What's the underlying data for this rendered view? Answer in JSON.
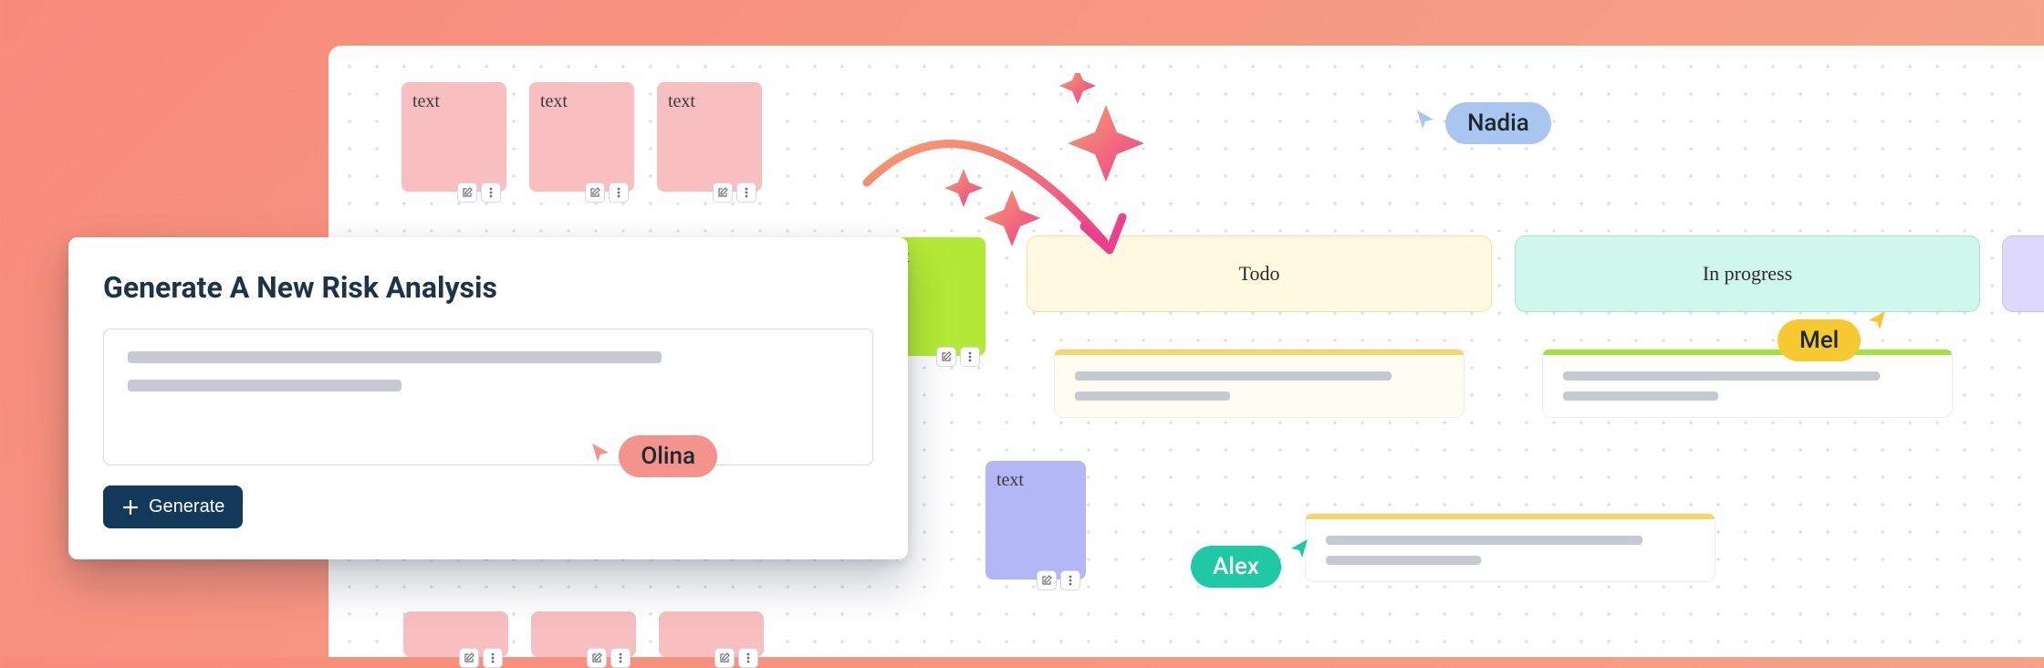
{
  "notes": {
    "row1": [
      "text",
      "text",
      "text"
    ],
    "lime": "ext",
    "blue": "text"
  },
  "columns": {
    "todo": "Todo",
    "in_progress": "In progress"
  },
  "users": {
    "olina": "Olina",
    "nadia": "Nadia",
    "mel": "Mel",
    "alex": "Alex"
  },
  "modal": {
    "title": "Generate A New Risk Analysis",
    "generate_label": "Generate"
  },
  "colors": {
    "pink": "#f7bfbf",
    "lime": "#b3e936",
    "blue_note": "#b4b7f5",
    "yellow_col": "#fef9e0",
    "yellow_col_border": "#f0e4a4",
    "mint_col": "#d0f7ec",
    "mint_col_border": "#a6e4d6",
    "violet_col": "#ded9fb",
    "stripe_yellow": "#f4d66a",
    "stripe_green": "#a4e23c",
    "olina_pill": "#f3938c",
    "nadia_pill": "#a9c6f0",
    "mel_pill": "#f6c931",
    "alex_pill": "#1fc9a3",
    "generate_btn": "#12395a"
  }
}
